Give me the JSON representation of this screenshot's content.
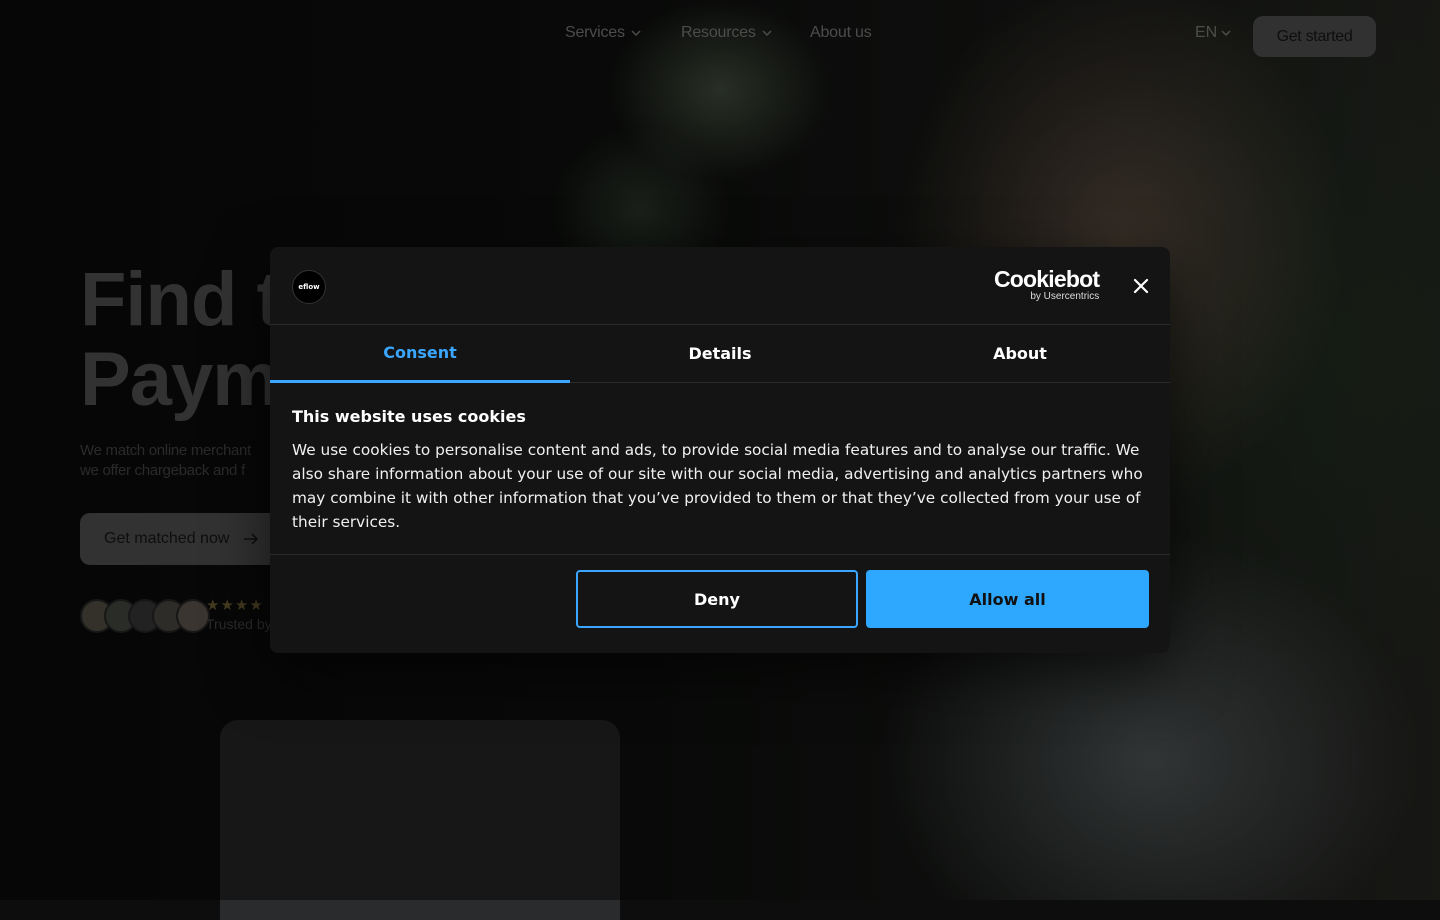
{
  "nav": {
    "services": "Services",
    "resources": "Resources",
    "about": "About us",
    "language": "EN",
    "get_started": "Get started"
  },
  "hero": {
    "title_line1": "Find t",
    "title_line2": "Paym",
    "subtitle_line1": "We match online merchant",
    "subtitle_line2": "we offer chargeback and f",
    "cta": "Get matched now",
    "stars": "★★★★",
    "trusted": "Trusted by"
  },
  "cookie_dialog": {
    "logo_text": "eflow",
    "brand_name": "Cookiebot",
    "brand_by": "by Usercentrics",
    "tabs": [
      "Consent",
      "Details",
      "About"
    ],
    "active_tab": "Consent",
    "heading": "This website uses cookies",
    "body": "We use cookies to personalise content and ads, to provide social media features and to analyse our traffic. We also share information about your use of our site with our social media, advertising and analytics partners who may combine it with other information that you’ve provided to them or that they’ve collected from your use of their services.",
    "deny": "Deny",
    "allow_all": "Allow all"
  },
  "colors": {
    "accent": "#2ea7ff",
    "dialog_bg": "#141414"
  }
}
